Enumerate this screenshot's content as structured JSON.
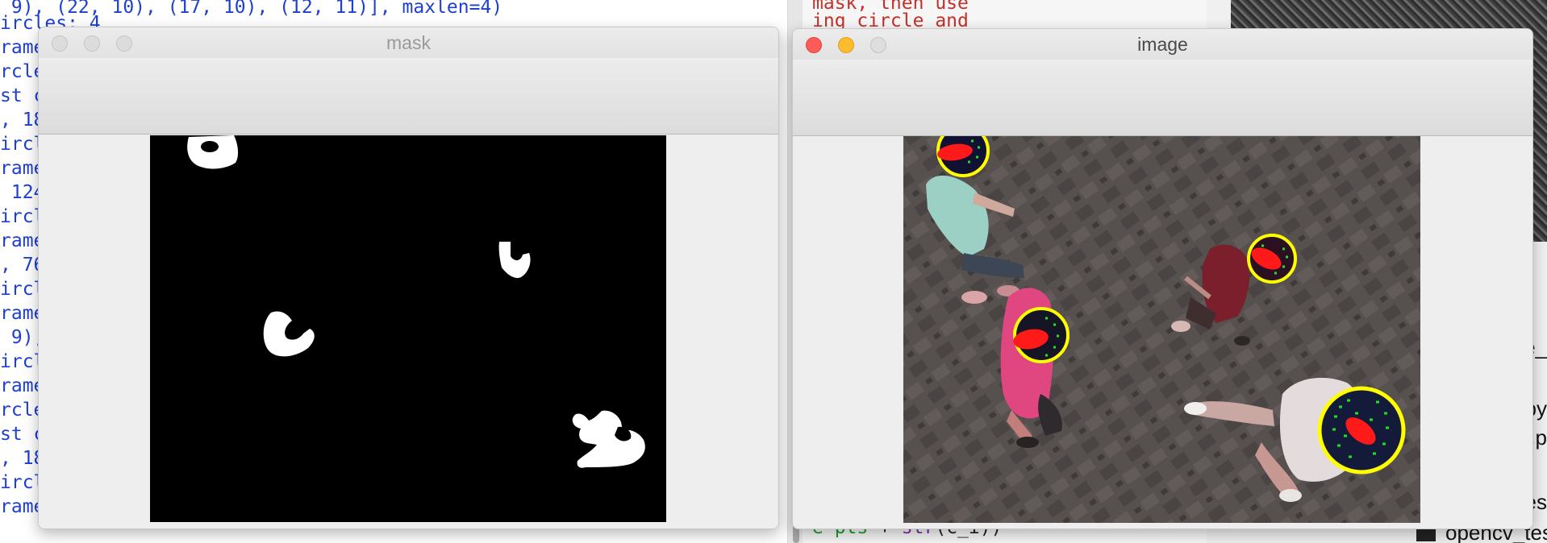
{
  "terminal": {
    "lines": [
      " 9), (22, 10), (17, 10), (12, 11)], maxlen=4)",
      "ircles: 4",
      "rame",
      "rcle",
      "st c",
      ", 18",
      "ircl",
      "rame",
      " 124",
      "ircl",
      "rame",
      ", 76",
      "ircl",
      "rame",
      " 9),",
      "ircl",
      "rame",
      "rcle",
      "st c",
      ", 18",
      "ircl",
      "rame"
    ]
  },
  "editor": {
    "lines": [
      "mask, then use",
      "ing circle and"
    ],
    "bottom": {
      "var": "e pts",
      "op": " + ",
      "fn": "str",
      "rest": "(c_i))"
    }
  },
  "right_panel": {
    "side_texts": [
      "ne_",
      "py",
      "t.p",
      "es"
    ],
    "file_label": "opencv_tes"
  },
  "mask_window": {
    "title": "mask",
    "title_color": "#9a9a9a",
    "frame_background": "#000000",
    "blob_color": "#ffffff"
  },
  "image_window": {
    "title": "image",
    "title_color": "#4a4a4a",
    "ring_color": "#ffff00",
    "marker_color": "#ff1a1a",
    "point_color": "#22e022",
    "floor_color": "#56504f"
  }
}
